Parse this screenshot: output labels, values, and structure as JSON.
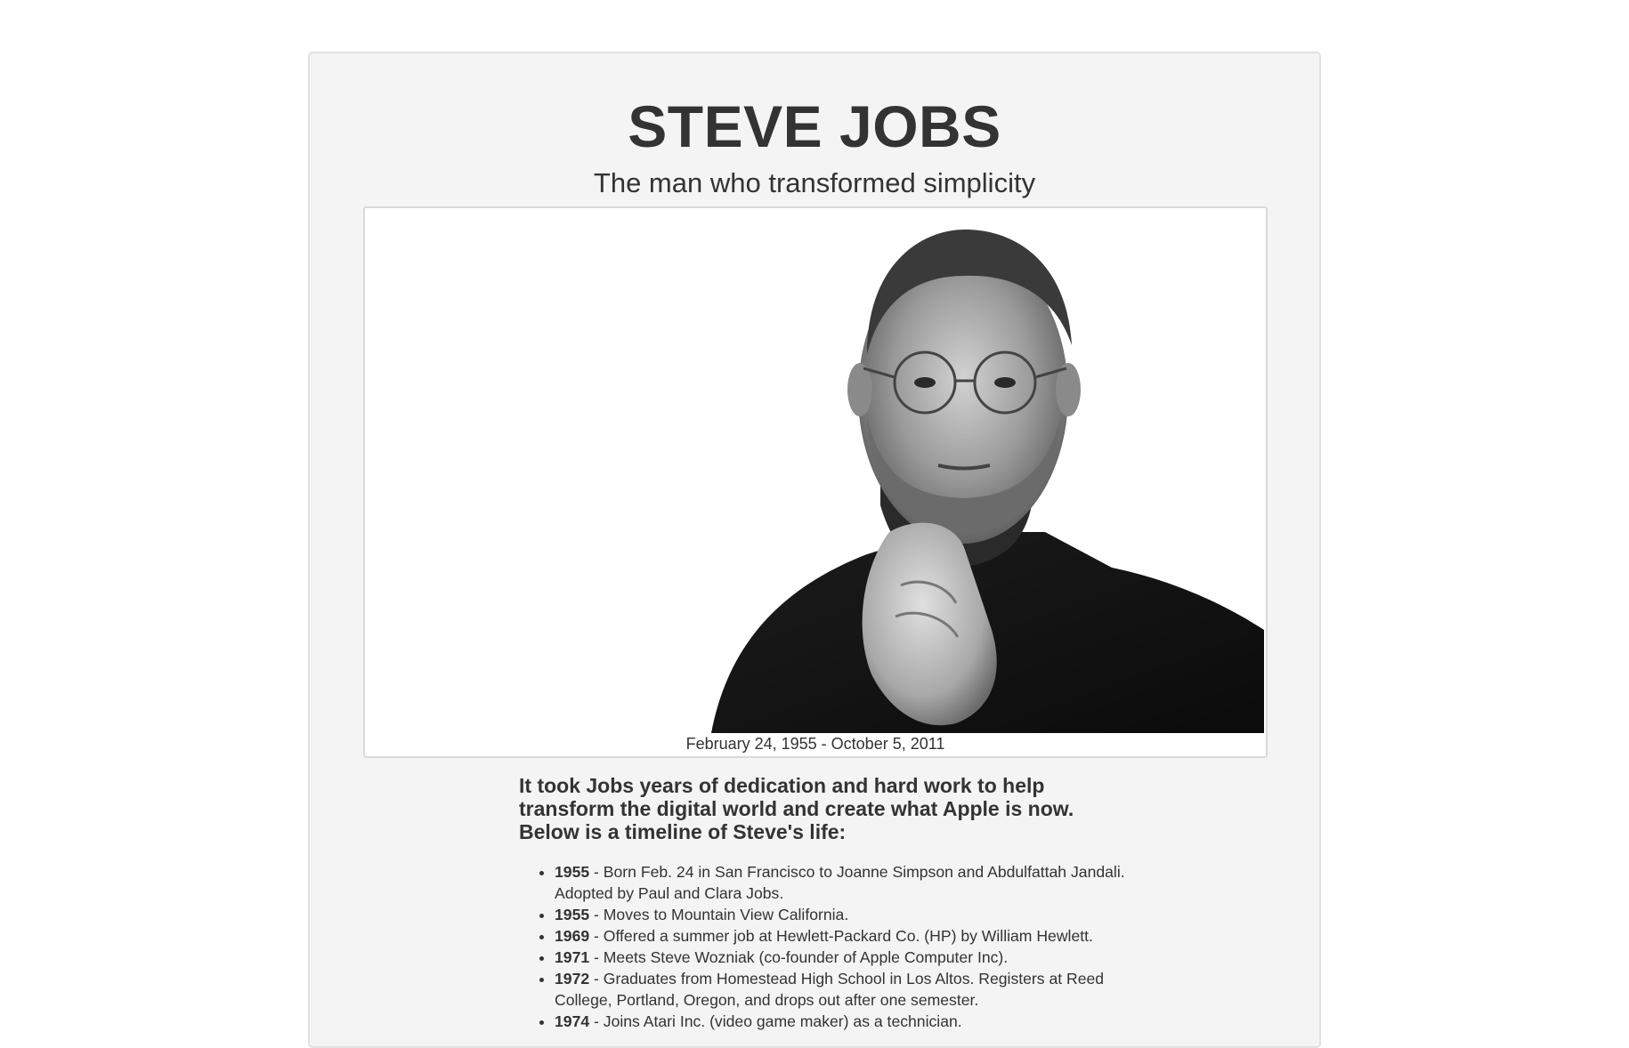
{
  "header": {
    "title": "STEVE JOBS",
    "subtitle": "The man who transformed simplicity"
  },
  "figure": {
    "image": "portrait-photo",
    "caption": "February 24, 1955 - October 5, 2011"
  },
  "intro": "It took Jobs years of dedication and hard work to help transform the digital world and create what Apple is now. Below is a timeline of Steve's life:",
  "timeline": [
    {
      "year": "1955",
      "text": " - Born Feb. 24 in San Francisco to Joanne Simpson and Abdulfattah Jandali. Adopted by Paul and Clara Jobs."
    },
    {
      "year": "1955",
      "text": " - Moves to Mountain View California."
    },
    {
      "year": "1969",
      "text": " - Offered a summer job at Hewlett-Packard Co. (HP) by William Hewlett."
    },
    {
      "year": "1971",
      "text": " - Meets Steve Wozniak (co-founder of Apple Computer Inc)."
    },
    {
      "year": "1972",
      "text": " - Graduates from Homestead High School in Los Altos. Registers at Reed College, Portland, Oregon, and drops out after one semester."
    },
    {
      "year": "1974",
      "text": " - Joins Atari Inc. (video game maker) as a technician."
    }
  ],
  "colors": {
    "page_background": "#ffffff",
    "card_background": "#f4f4f4",
    "text": "#333333"
  }
}
